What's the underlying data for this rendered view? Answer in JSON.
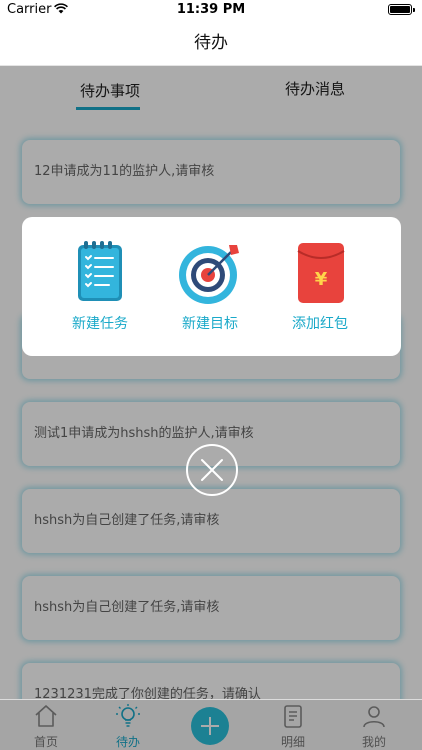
{
  "status_bar": {
    "carrier": "Carrier",
    "time": "11:39 PM"
  },
  "nav": {
    "title": "待办"
  },
  "tabs": [
    {
      "label": "待办事项",
      "active": true
    },
    {
      "label": "待办消息",
      "active": false
    }
  ],
  "list_items": [
    {
      "text": "12申请成为11的监护人,请审核"
    },
    {
      "text": ""
    },
    {
      "text": "测试1申请成为hshsh的监护人,请审核"
    },
    {
      "text": "hshsh为自己创建了任务,请审核"
    },
    {
      "text": "hshsh为自己创建了任务,请审核"
    },
    {
      "text": "1231231完成了你创建的任务，请确认"
    }
  ],
  "popup": {
    "items": [
      {
        "label": "新建任务",
        "icon": "task-list-icon"
      },
      {
        "label": "新建目标",
        "icon": "target-icon"
      },
      {
        "label": "添加红包",
        "icon": "red-envelope-icon"
      }
    ],
    "close_icon": "close-icon"
  },
  "tabbar": {
    "items": [
      {
        "label": "首页",
        "icon": "home-icon",
        "active": false
      },
      {
        "label": "待办",
        "icon": "lightbulb-icon",
        "active": true
      },
      {
        "label": "明细",
        "icon": "document-icon",
        "active": false
      },
      {
        "label": "我的",
        "icon": "user-icon",
        "active": false
      }
    ],
    "center_icon": "plus-icon"
  },
  "colors": {
    "accent": "#1aa9c9",
    "overlay": "rgba(0,0,0,0.33)",
    "red": "#e8433d"
  }
}
